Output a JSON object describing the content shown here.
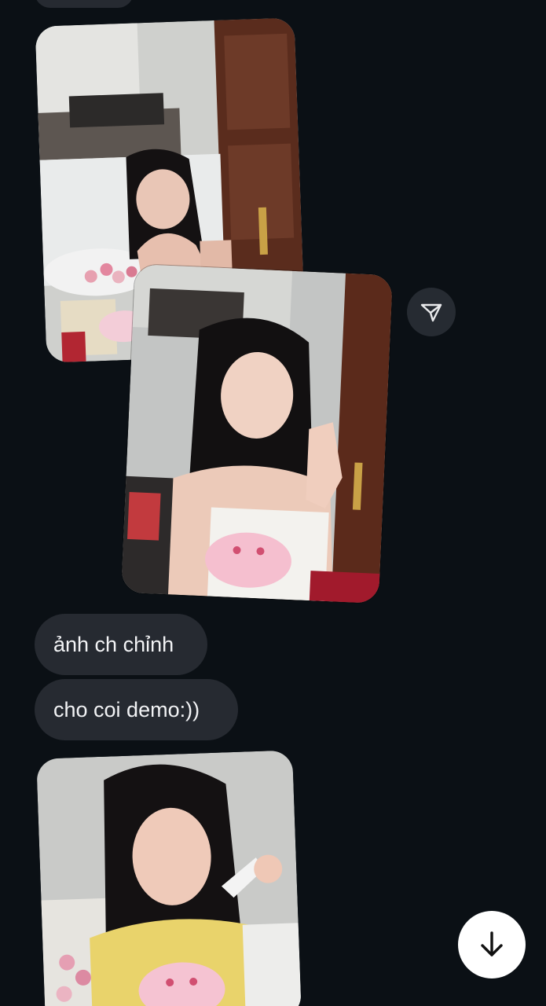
{
  "messages": [
    {
      "text": "ảnh ch chỉnh"
    },
    {
      "text": "cho coi demo:))"
    }
  ],
  "icons": {
    "share": "send-triangle-icon",
    "scroll": "arrow-down-icon"
  },
  "colors": {
    "background": "#0b1015",
    "bubble": "#262a31",
    "text": "#f2f3f5",
    "scroll_button": "#ffffff"
  }
}
